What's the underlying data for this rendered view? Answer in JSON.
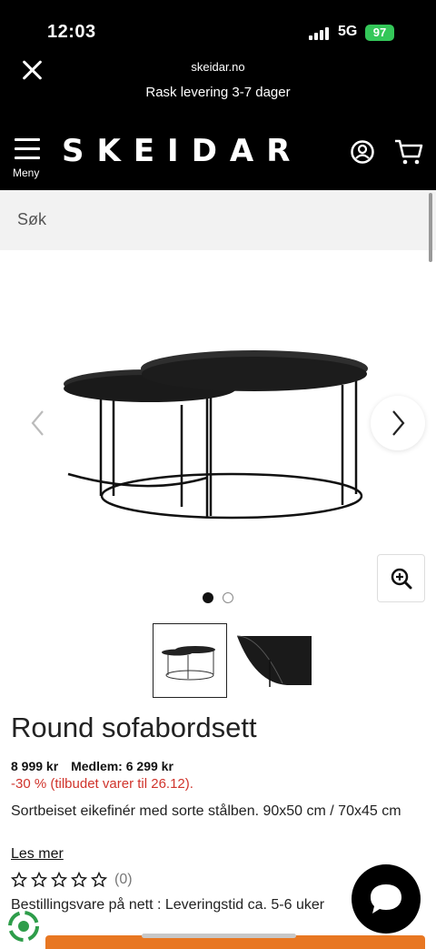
{
  "status_bar": {
    "time": "12:03",
    "network": "5G",
    "battery": "97"
  },
  "browser": {
    "url": "skeidar.no",
    "subtitle": "Rask levering 3-7 dager"
  },
  "header": {
    "menu_label": "Meny",
    "logo": "SKEIDAR"
  },
  "search": {
    "placeholder": "Søk"
  },
  "gallery": {
    "current_index": 1,
    "total": 2
  },
  "product": {
    "title": "Round sofabordsett",
    "price_original": "8 999 kr",
    "price_member": "Medlem: 6 299 kr",
    "discount": "-30 % (tilbudet varer til 26.12).",
    "description": "Sortbeiset eikefinér med sorte stålben. 90x50 cm / 70x45 cm",
    "read_more": "Les mer",
    "rating": 0,
    "rating_max": 5,
    "review_count": "(0)",
    "delivery": "Bestillingsvare på nett : Leveringstid ca. 5-6 uker"
  },
  "colors": {
    "header_bg": "#000000",
    "search_bg": "#f2f2f2",
    "discount": "#d0342c",
    "cta": "#e87722",
    "battery": "#34c759"
  }
}
